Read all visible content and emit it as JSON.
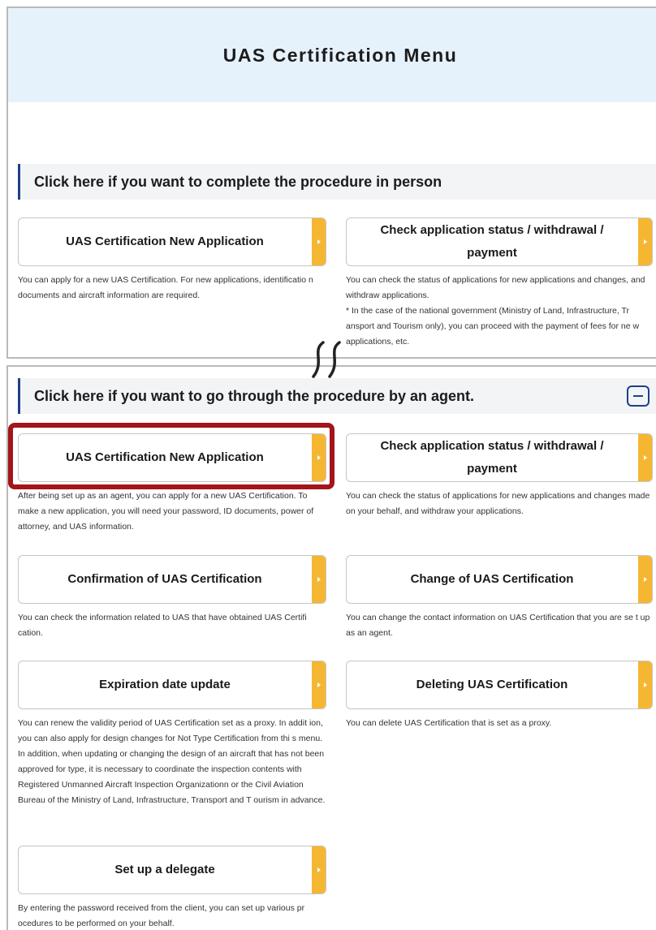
{
  "header": {
    "title": "UAS Certification Menu"
  },
  "in_person": {
    "heading": "Click here if you want to complete the procedure in person",
    "cards": [
      {
        "label": "UAS Certification New Application",
        "description": "You can apply for a new UAS Certification. For new applications, identificatio n documents and aircraft information are required."
      },
      {
        "label_line1": "Check application status / withdrawal /",
        "label_line2": "payment",
        "description_line1": "You can check the status of applications for new applications and changes, and withdraw applications.",
        "description_line2": "* In the case of the national government (Ministry of Land, Infrastructure, Tr ansport and Tourism only), you can proceed with the payment of fees for ne w applications, etc."
      }
    ]
  },
  "agent": {
    "heading": "Click here if you want to go through the procedure by an agent.",
    "collapse_label": "−",
    "cards": [
      {
        "label": "UAS Certification New Application",
        "description": "After being set up as an agent, you can apply for a new UAS Certification. To make a new application, you will need your password, ID documents, power of attorney, and UAS information."
      },
      {
        "label_line1": "Check application status / withdrawal /",
        "label_line2": "payment",
        "description": "You can check the status of applications for new applications and changes made on your behalf, and withdraw your applications."
      },
      {
        "label": "Confirmation of UAS Certification",
        "description": "You can check the information related to UAS that have obtained UAS Certifi cation."
      },
      {
        "label": "Change of UAS Certification",
        "description": "You can change the contact information on UAS Certification that you are se t up as an agent."
      },
      {
        "label": "Expiration date update",
        "description": "You can renew the validity period of UAS Certification set as a proxy. In addit ion, you can also apply for design changes for Not Type Certification from thi s menu. In addition, when updating or changing the design of an aircraft that has not been approved for type, it is necessary to coordinate the inspection contents with Registered Unmanned Aircraft Inspection Organizationn or the Civil Aviation Bureau of the Ministry of Land, Infrastructure, Transport and T ourism in advance."
      },
      {
        "label": "Deleting UAS Certification",
        "description": "You can delete UAS Certification that is set as a proxy."
      },
      {
        "label": "Set up a delegate",
        "description": "By entering the password received from the client, you can set up various pr ocedures to be performed on your behalf."
      }
    ]
  },
  "colors": {
    "accent_tab": "#f5b731",
    "header_band": "#e6f2fb",
    "section_bar": "#1f3f8a",
    "highlight": "#a3141b"
  },
  "icons": [
    "chevron-right-icon",
    "collapse-minus-icon",
    "section-break-icon"
  ]
}
